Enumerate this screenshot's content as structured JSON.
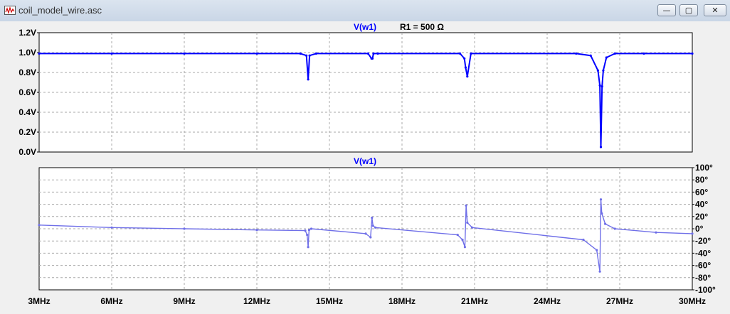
{
  "window": {
    "title": "coil_model_wire.asc",
    "minimize_glyph": "—",
    "maximize_glyph": "▢",
    "close_glyph": "✕",
    "app_icon": "waveform-viewer-icon"
  },
  "header": {
    "trace_label": "V(w1)",
    "step_label": "R1 = 500 Ω"
  },
  "colors": {
    "trace": "#0000ff",
    "trace_phase": "#6f6fe8",
    "step_label": "#000000",
    "grid": "#a8a8a8",
    "plot_bg": "#ffffff"
  },
  "chart_data": [
    {
      "type": "line",
      "title": "V(w1)",
      "xlabel": "",
      "ylabel": "",
      "xlim": [
        3,
        30
      ],
      "ylim": [
        0,
        1.2
      ],
      "grid": true,
      "x_tick_labels": [
        "3MHz",
        "6MHz",
        "9MHz",
        "12MHz",
        "15MHz",
        "18MHz",
        "21MHz",
        "24MHz",
        "27MHz",
        "30MHz"
      ],
      "y_ticks": [
        0,
        0.2,
        0.4,
        0.6,
        0.8,
        1.0,
        1.2
      ],
      "y_tick_labels": [
        "0.0V",
        "0.2V",
        "0.4V",
        "0.6V",
        "0.8V",
        "1.0V",
        "1.2V"
      ],
      "series": [
        {
          "name": "V(w1)",
          "x": [
            3.0,
            6.0,
            9.0,
            12.0,
            13.8,
            14.05,
            14.12,
            14.18,
            14.45,
            16.6,
            16.74,
            16.78,
            16.82,
            17.0,
            20.4,
            20.58,
            20.63,
            20.7,
            20.85,
            25.2,
            25.8,
            26.1,
            26.18,
            26.22,
            26.27,
            26.32,
            26.45,
            26.8,
            28.0,
            30.0
          ],
          "y": [
            0.99,
            0.99,
            0.99,
            0.99,
            0.99,
            0.97,
            0.73,
            0.97,
            0.99,
            0.99,
            0.94,
            0.94,
            0.99,
            0.99,
            0.99,
            0.94,
            0.85,
            0.76,
            0.99,
            0.99,
            0.97,
            0.82,
            0.67,
            0.05,
            0.66,
            0.82,
            0.95,
            0.99,
            0.99,
            0.99
          ]
        }
      ]
    },
    {
      "type": "line",
      "title": "V(w1)",
      "xlabel": "",
      "ylabel": "",
      "xlim": [
        3,
        30
      ],
      "ylim": [
        -100,
        100
      ],
      "grid": true,
      "x_tick_labels": [
        "3MHz",
        "6MHz",
        "9MHz",
        "12MHz",
        "15MHz",
        "18MHz",
        "21MHz",
        "24MHz",
        "27MHz",
        "30MHz"
      ],
      "y_ticks": [
        -100,
        -80,
        -60,
        -40,
        -20,
        0,
        20,
        40,
        60,
        80,
        100
      ],
      "y_tick_labels": [
        "-100°",
        "-80°",
        "-60°",
        "-40°",
        "-20°",
        "0°",
        "20°",
        "40°",
        "60°",
        "80°",
        "100°"
      ],
      "series": [
        {
          "name": "V(w1)",
          "x": [
            3.0,
            6.0,
            9.0,
            12.0,
            14.0,
            14.08,
            14.12,
            14.16,
            14.25,
            16.5,
            16.7,
            16.76,
            16.8,
            16.9,
            20.3,
            20.5,
            20.6,
            20.65,
            20.7,
            20.9,
            25.5,
            26.05,
            26.18,
            26.22,
            26.26,
            26.4,
            26.8,
            28.5,
            30.0
          ],
          "y": [
            6,
            2,
            0,
            -2,
            -3,
            -10,
            -30,
            -2,
            0,
            -8,
            -14,
            18,
            5,
            2,
            -10,
            -18,
            -30,
            38,
            10,
            2,
            -18,
            -35,
            -70,
            48,
            25,
            8,
            0,
            -6,
            -8
          ]
        }
      ]
    }
  ]
}
